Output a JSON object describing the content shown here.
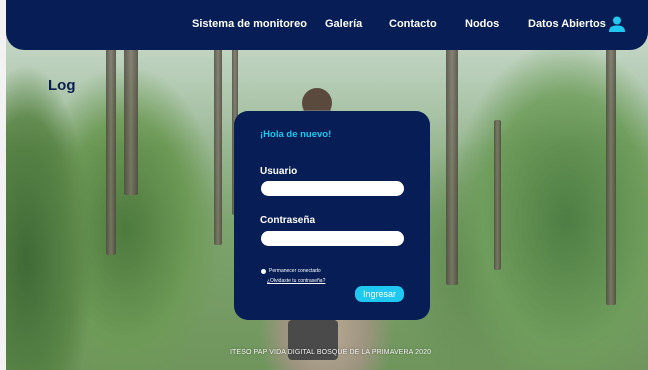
{
  "nav": {
    "items": [
      {
        "label": "Sistema de monitoreo"
      },
      {
        "label": "Galería"
      },
      {
        "label": "Contacto"
      },
      {
        "label": "Nodos"
      },
      {
        "label": "Datos Abiertos"
      }
    ],
    "user_icon": "user-icon"
  },
  "page": {
    "title": "Log"
  },
  "login": {
    "greeting": "¡Hola de nuevo!",
    "username_label": "Usuario",
    "username_value": "",
    "password_label": "Contraseña",
    "password_value": "",
    "remember_label": "Permanecer conectado",
    "forgot_label": "¿Olvidaste tu contraseña?",
    "submit_label": "Ingresar"
  },
  "footer": {
    "text": "ITESO PAP VIDA DIGITAL BOSQUE DE LA PRIMAVERA 2020"
  },
  "colors": {
    "navy": "#061d55",
    "accent": "#1ec8f0",
    "title": "#0a1f4e"
  }
}
